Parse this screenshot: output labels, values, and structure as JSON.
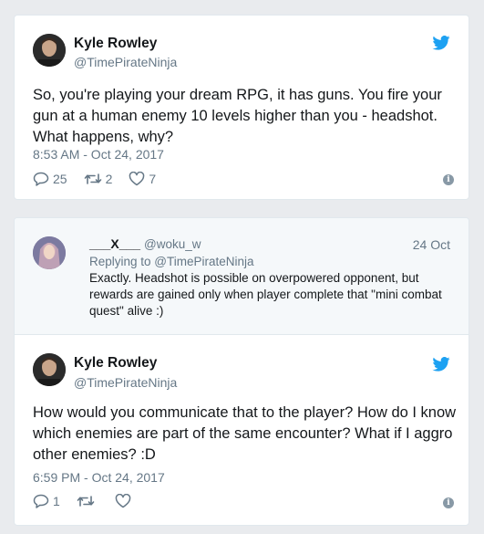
{
  "colors": {
    "twitter_blue": "#1da1f2",
    "muted": "#657786",
    "text": "#14171a",
    "border": "#e1e8ed"
  },
  "tweet1": {
    "author_name": "Kyle Rowley",
    "author_handle": "@TimePirateNinja",
    "text_lines": [
      "So, you're playing your dream RPG, it has guns. You fire your",
      "gun at a human enemy 10 levels higher than you - headshot.",
      "What happens, why?"
    ],
    "timestamp": "8:53 AM - Oct 24, 2017",
    "reply_count": "25",
    "retweet_count": "2",
    "like_count": "7"
  },
  "reply": {
    "author_name": "___X___",
    "author_handle": "@woku_w",
    "date": "24 Oct",
    "replying_to": "Replying to @TimePirateNinja",
    "text_lines": [
      "Exactly. Headshot is possible on overpowered opponent, but",
      "rewards are gained only when player complete that \"mini combat",
      "quest\" alive :)"
    ]
  },
  "tweet2": {
    "author_name": "Kyle Rowley",
    "author_handle": "@TimePirateNinja",
    "text_lines": [
      "How would you communicate that to the player? How do I know",
      "which enemies are part of the same encounter? What if I aggro",
      "other enemies? :D"
    ],
    "timestamp": "6:59 PM - Oct 24, 2017",
    "reply_count": "1",
    "retweet_count": "",
    "like_count": ""
  },
  "icons": {
    "bird": "twitter-bird-icon",
    "reply": "reply-icon",
    "retweet": "retweet-icon",
    "like": "heart-icon",
    "info": "info-icon"
  }
}
